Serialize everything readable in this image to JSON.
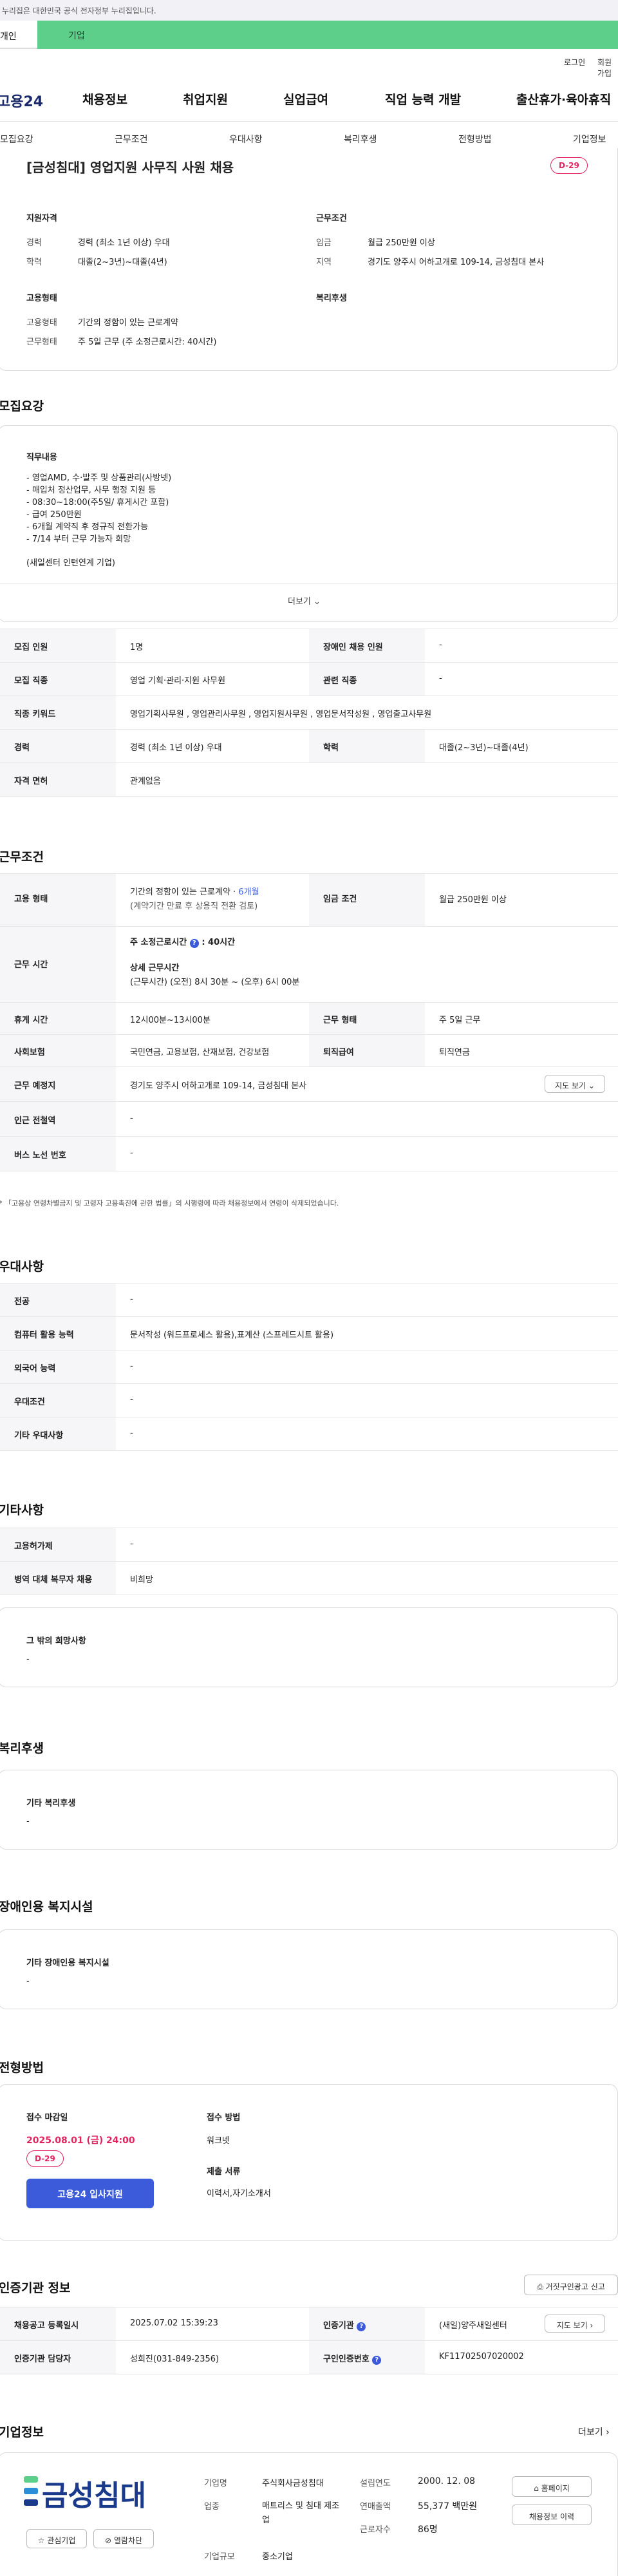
{
  "gov_banner": "이 누리집은 대한민국 공식 전자정부 누리집입니다.",
  "top_tabs": [
    "개인",
    "기업"
  ],
  "util_links": [
    "로그인",
    "회원가입"
  ],
  "site_logo": "고용24",
  "gnb": [
    "채용정보",
    "취업지원",
    "실업급여",
    "직업 능력 개발",
    "출산휴가·육아휴직"
  ],
  "subnav": [
    "모집요강",
    "근무조건",
    "우대사항",
    "복리후생",
    "전형방법",
    "기업정보"
  ],
  "job": {
    "title": "[금성침대] 영업지원 사무직 사원 채용",
    "dday": "D-29"
  },
  "summary": {
    "qual_title": "지원자격",
    "work_title": "근무조건",
    "emp_title": "고용형태",
    "welfare_title": "복리후생",
    "career_label": "경력",
    "career": "경력 (최소 1년 이상) 우대",
    "edu_label": "학력",
    "edu": "대졸(2~3년)~대졸(4년)",
    "wage_label": "임금",
    "wage": "월급 250만원 이상",
    "area_label": "지역",
    "area": "경기도 양주시 어하고개로 109-14, 금성침대 본사",
    "emptype_label": "고용형태",
    "emptype": "기간의 정함이 있는 근로계약",
    "worktype_label": "근무형태",
    "worktype": "주 5일 근무 (주 소정근로시간: 40시간)"
  },
  "recruit": {
    "heading": "모집요강",
    "duty_title": "직무내용",
    "duty_lines": [
      "- 영업AMD, 수·발주 및 상품관리(사방넷)",
      "- 매입처 정산업무, 사무 행정 지원 등",
      "- 08:30~18:00(주5일/ 휴게시간 포함)",
      "- 급여 250만원",
      "- 6개월 계약직 후 정규직 전환가능",
      "- 7/14 부터 근무 가능자 희망"
    ],
    "duty_note": "(새일센터 인턴연계 기업)",
    "more": "더보기",
    "rows": [
      {
        "l1": "모집 인원",
        "v1": "1명",
        "l2": "장애인 채용 인원",
        "v2": "-"
      },
      {
        "l1": "모집 직종",
        "v1": "영업 기획·관리·지원 사무원",
        "l2": "관련 직종",
        "v2": "-"
      },
      {
        "l1": "직종 키워드",
        "v1": "영업기획사무원 , 영업관리사무원 , 영업지원사무원 , 영업문서작성원 , 영업출고사무원",
        "l2": "",
        "v2": ""
      },
      {
        "l1": "경력",
        "v1": "경력 (최소 1년 이상) 우대",
        "l2": "학력",
        "v2": "대졸(2~3년)~대졸(4년)"
      },
      {
        "l1": "자격 면허",
        "v1": "관계없음",
        "l2": "",
        "v2": ""
      }
    ]
  },
  "condition": {
    "heading": "근무조건",
    "emp_label": "고용 형태",
    "emp_value": "기간의 정함이 있는 근로계약 · ",
    "emp_months": "6개월",
    "emp_sub": "(계약기간 만료 후 상용직 전환 검토)",
    "wage_label": "임금 조건",
    "wage_value": "월급 250만원 이상",
    "time_label": "근무 시간",
    "weekly": "주 소정근로시간",
    "weekly_val": ": 40시간",
    "detail_title": "상세 근무시간",
    "detail_val": "(근무시간) (오전) 8시 30분 ~ (오후) 6시 00분",
    "rest_label": "휴게 시간",
    "rest_val": "12시00분~13시00분",
    "form_label": "근무 형태",
    "form_val": "주 5일 근무",
    "ins_label": "사회보험",
    "ins_val": "국민연금, 고용보험, 산재보험, 건강보험",
    "ret_label": "퇴직급여",
    "ret_val": "퇴직연금",
    "place_label": "근무 예정지",
    "place_val": "경기도 양주시 어하고개로 109-14, 금성침대 본사",
    "map_btn": "지도 보기",
    "station_label": "인근 전철역",
    "station_val": "-",
    "bus_label": "버스 노선 번호",
    "bus_val": "-",
    "note": "* 「고용상 연령차별금지 및 고령자 고용촉진에 관한 법률」의 시행령에 따라 채용정보에서 연령이 삭제되었습니다."
  },
  "prefer": {
    "heading": "우대사항",
    "rows": [
      {
        "l": "전공",
        "v": "-"
      },
      {
        "l": "컴퓨터 활용 능력",
        "v": "문서작성 (워드프로세스 활용),표계산 (스프레드시트 활용)"
      },
      {
        "l": "외국어 능력",
        "v": "-"
      },
      {
        "l": "우대조건",
        "v": "-"
      },
      {
        "l": "기타 우대사항",
        "v": "-"
      }
    ]
  },
  "other": {
    "heading": "기타사항",
    "rows": [
      {
        "l": "고용허가제",
        "v": "-"
      },
      {
        "l": "병역 대체 복무자 채용",
        "v": "비희망"
      }
    ],
    "hope_title": "그 밖의 희망사항",
    "hope_val": "-"
  },
  "welfare": {
    "heading": "복리후생",
    "box_title": "기타 복리후생",
    "box_val": "-"
  },
  "facility": {
    "heading": "장애인용 복지시설",
    "box_title": "기타 장애인용 복지시설",
    "box_val": "-"
  },
  "screening": {
    "heading": "전형방법",
    "deadline_title": "접수 마감일",
    "deadline": "2025.08.01 (금) 24:00",
    "dday": "D-29",
    "apply_btn": "고용24 입사지원",
    "method_title": "접수 방법",
    "method": "워크넷",
    "docs_title": "제출 서류",
    "docs": "이력서,자기소개서"
  },
  "cert": {
    "heading": "인증기관 정보",
    "report_btn": "거짓구인광고 신고",
    "reg_label": "채용공고 등록일시",
    "reg_val": "2025.07.02 15:39:23",
    "org_label": "인증기관",
    "org_val": "(새일)양주새일센터",
    "map_btn": "지도 보기",
    "mgr_label": "인증기관 담당자",
    "mgr_val": "성희진(031-849-2356)",
    "num_label": "구인인증번호",
    "num_val": "KF11702507020002"
  },
  "company": {
    "heading": "기업정보",
    "more": "더보기",
    "logo": "금성침대",
    "fav_btn": "관심기업",
    "block_btn": "열람차단",
    "name_label": "기업명",
    "name_val": "주식회사금성침대",
    "est_label": "설립연도",
    "est_val": "2000. 12. 08",
    "ind_label": "업종",
    "ind_val": "매트리스 및 침대 제조업",
    "rev_label": "연매출액",
    "rev_val": "55,377 백만원",
    "size_label": "기업규모",
    "size_val": "중소기업",
    "emp_label": "근로자수",
    "emp_val": "86명",
    "home_btn": "홈페이지",
    "jobs_btn": "채용정보 이력"
  },
  "colors": {
    "brand_green": "#5ecf8a",
    "accent_red": "#e0245e",
    "blue": "#3b5bdb"
  }
}
